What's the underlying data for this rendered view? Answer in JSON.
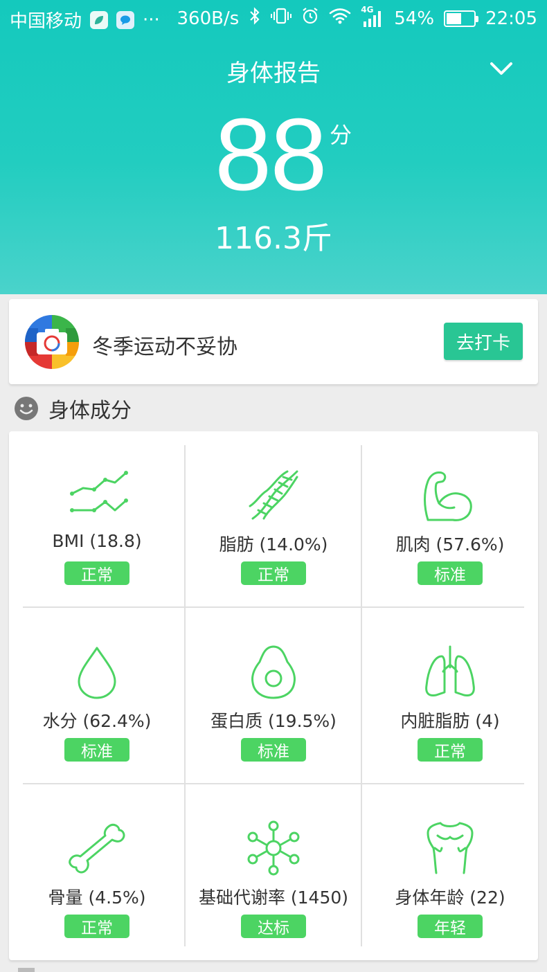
{
  "status_bar": {
    "carrier": "中国移动",
    "more": "···",
    "speed": "360B/s",
    "network": "4G",
    "battery": "54%",
    "time": "22:05",
    "battery_level": 0.54
  },
  "header": {
    "title": "身体报告",
    "score": "88",
    "score_unit": "分",
    "weight": "116.3斤"
  },
  "banner": {
    "text": "冬季运动不妥协",
    "button_label": "去打卡"
  },
  "section": {
    "title": "身体成分"
  },
  "metrics": [
    {
      "label": "BMI (18.8)",
      "status": "正常",
      "icon": "trend-chart-icon"
    },
    {
      "label": "脂肪 (14.0%)",
      "status": "正常",
      "icon": "dna-icon"
    },
    {
      "label": "肌肉 (57.6%)",
      "status": "标准",
      "icon": "muscle-arm-icon"
    },
    {
      "label": "水分 (62.4%)",
      "status": "标准",
      "icon": "water-drop-icon"
    },
    {
      "label": "蛋白质 (19.5%)",
      "status": "标准",
      "icon": "avocado-icon"
    },
    {
      "label": "内脏脂肪 (4)",
      "status": "正常",
      "icon": "lungs-icon"
    },
    {
      "label": "骨量 (4.5%)",
      "status": "正常",
      "icon": "bone-icon"
    },
    {
      "label": "基础代谢率 (1450)",
      "status": "达标",
      "icon": "molecule-icon"
    },
    {
      "label": "身体年龄 (22)",
      "status": "年轻",
      "icon": "torso-icon"
    }
  ],
  "colors": {
    "header_top": "#14c9bd",
    "header_bottom": "#4ad3cb",
    "badge_green": "#4cd463",
    "button_green": "#29c694",
    "icon_stroke": "#4cd463"
  }
}
